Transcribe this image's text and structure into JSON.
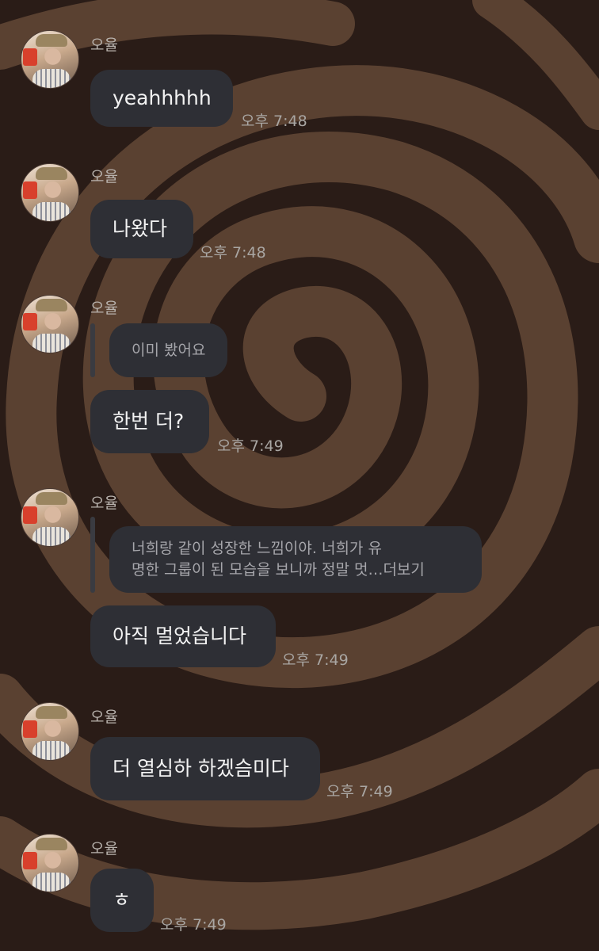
{
  "messages": [
    {
      "sender": "오율",
      "text": "yeahhhhh",
      "time": "오후 7:48"
    },
    {
      "sender": "오율",
      "text": "나왔다",
      "time": "오후 7:48"
    },
    {
      "sender": "오율",
      "quote": "이미 봤어요",
      "text": "한번 더?",
      "time": "오후 7:49"
    },
    {
      "sender": "오율",
      "quote_line1": "너희랑 같이 성장한 느낌이야. 너희가 유",
      "quote_line2": "명한 그룹이 된 모습을 보니까 정말 멋…",
      "more_label": "더보기",
      "text": "아직 멀었습니다",
      "time": "오후 7:49"
    },
    {
      "sender": "오율",
      "text": "더 열심하 하겠슴미다",
      "time": "오후 7:49"
    },
    {
      "sender": "오율",
      "text": "ㅎ",
      "time": "오후 7:49"
    }
  ],
  "colors": {
    "background": "#2a1c17",
    "swirl": "#5a4131",
    "bubble": "#2e2f35",
    "timestamp": "#a9a6a3"
  },
  "icons": {
    "avatar": "profile-photo"
  }
}
